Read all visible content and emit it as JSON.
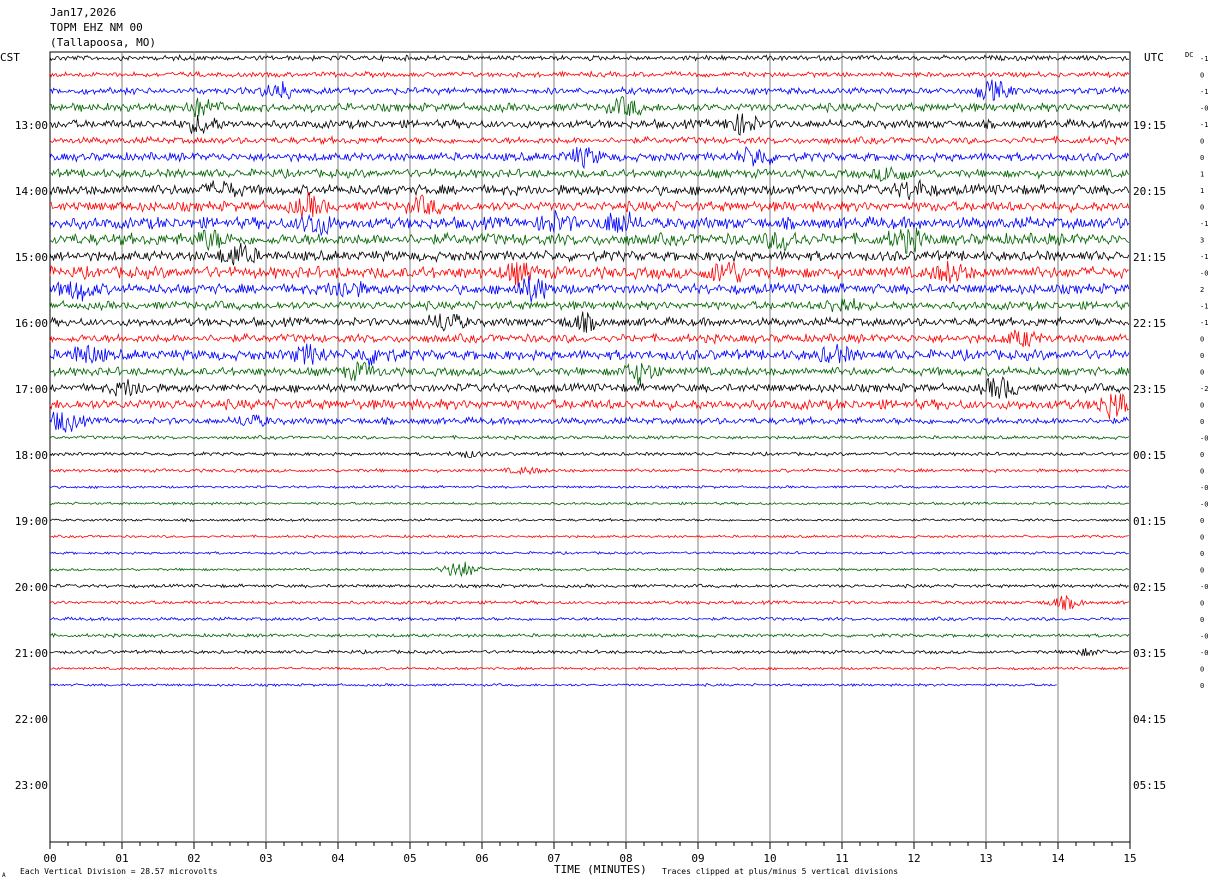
{
  "header": {
    "date": "Jan17,2026",
    "station": "TOPM EHZ NM 00",
    "location": "(Tallapoosa, MO)"
  },
  "left_tz": "CST",
  "right_tz": "UTC",
  "dc_label": "DC",
  "footer": {
    "vertical_division": "Each Vertical Division =   28.57 microvolts",
    "clip_note": "Traces clipped at plus/minus 5 vertical divisions",
    "corner_mark": "A"
  },
  "chart_data": {
    "type": "line",
    "title": "TOPM EHZ NM 00",
    "xlabel": "TIME (MINUTES)",
    "ylabel": "",
    "xlim": [
      0,
      15
    ],
    "x_ticks": [
      "00",
      "01",
      "02",
      "03",
      "04",
      "05",
      "06",
      "07",
      "08",
      "09",
      "10",
      "11",
      "12",
      "13",
      "14",
      "15"
    ],
    "left_hour_labels": [
      "13:00",
      "14:00",
      "15:00",
      "16:00",
      "17:00",
      "18:00",
      "19:00",
      "20:00",
      "21:00",
      "22:00",
      "23:00"
    ],
    "right_hour_labels": [
      "19:15",
      "20:15",
      "21:15",
      "22:15",
      "23:15",
      "00:15",
      "01:15",
      "02:15",
      "03:15",
      "04:15",
      "05:15"
    ],
    "trace_colors": [
      "#000000",
      "#ff0000",
      "#0000ff",
      "#006400"
    ],
    "traces_per_hour": 4,
    "trace_count": 39,
    "last_trace_end_minute": 14,
    "dc_offsets": [
      "-1",
      "0",
      "-1",
      "-0",
      "-1",
      "0",
      "0",
      "1",
      "1",
      "0",
      "-1",
      "3",
      "-1",
      "-0",
      "2",
      "-1",
      "-1",
      "0",
      "0",
      "0",
      "-2",
      "0",
      "0",
      "-0",
      "0",
      "0",
      "-0",
      "-0",
      "0",
      "0",
      "0",
      "0",
      "-0",
      "0",
      "0",
      "-0",
      "-0",
      "0",
      "0"
    ],
    "trace_amplitude": [
      3,
      3,
      4,
      5,
      5,
      4,
      5,
      5,
      6,
      6,
      7,
      7,
      6,
      7,
      6,
      5,
      5,
      5,
      6,
      5,
      5,
      6,
      4,
      2,
      2,
      2,
      1.5,
      1.5,
      1.5,
      1.5,
      1.5,
      1.5,
      2,
      2,
      2,
      2,
      2,
      1.5,
      1.5
    ],
    "events": [
      {
        "trace": 2,
        "minute": 3.2,
        "amp": 8
      },
      {
        "trace": 2,
        "minute": 13.1,
        "amp": 9
      },
      {
        "trace": 3,
        "minute": 2.1,
        "amp": 8
      },
      {
        "trace": 3,
        "minute": 8.0,
        "amp": 8
      },
      {
        "trace": 4,
        "minute": 2.1,
        "amp": 8
      },
      {
        "trace": 4,
        "minute": 9.6,
        "amp": 9
      },
      {
        "trace": 6,
        "minute": 7.4,
        "amp": 8
      },
      {
        "trace": 6,
        "minute": 9.8,
        "amp": 9
      },
      {
        "trace": 7,
        "minute": 11.7,
        "amp": 7
      },
      {
        "trace": 8,
        "minute": 2.4,
        "amp": 7
      },
      {
        "trace": 8,
        "minute": 12.0,
        "amp": 8
      },
      {
        "trace": 9,
        "minute": 3.6,
        "amp": 9
      },
      {
        "trace": 9,
        "minute": 5.2,
        "amp": 7
      },
      {
        "trace": 10,
        "minute": 3.7,
        "amp": 10
      },
      {
        "trace": 10,
        "minute": 7.0,
        "amp": 8
      },
      {
        "trace": 10,
        "minute": 7.9,
        "amp": 10
      },
      {
        "trace": 11,
        "minute": 2.2,
        "amp": 8
      },
      {
        "trace": 11,
        "minute": 10.2,
        "amp": 9
      },
      {
        "trace": 11,
        "minute": 11.9,
        "amp": 9
      },
      {
        "trace": 12,
        "minute": 2.6,
        "amp": 10
      },
      {
        "trace": 13,
        "minute": 9.4,
        "amp": 11
      },
      {
        "trace": 13,
        "minute": 6.5,
        "amp": 8
      },
      {
        "trace": 13,
        "minute": 12.5,
        "amp": 8
      },
      {
        "trace": 14,
        "minute": 0.4,
        "amp": 9
      },
      {
        "trace": 14,
        "minute": 6.7,
        "amp": 11
      },
      {
        "trace": 14,
        "minute": 4.1,
        "amp": 8
      },
      {
        "trace": 15,
        "minute": 11.0,
        "amp": 7
      },
      {
        "trace": 16,
        "minute": 5.5,
        "amp": 9
      },
      {
        "trace": 16,
        "minute": 7.4,
        "amp": 7
      },
      {
        "trace": 17,
        "minute": 13.5,
        "amp": 7
      },
      {
        "trace": 18,
        "minute": 0.5,
        "amp": 8
      },
      {
        "trace": 18,
        "minute": 3.6,
        "amp": 8
      },
      {
        "trace": 18,
        "minute": 4.5,
        "amp": 8
      },
      {
        "trace": 18,
        "minute": 10.9,
        "amp": 7
      },
      {
        "trace": 19,
        "minute": 8.2,
        "amp": 10
      },
      {
        "trace": 19,
        "minute": 4.3,
        "amp": 7
      },
      {
        "trace": 20,
        "minute": 13.2,
        "amp": 10
      },
      {
        "trace": 20,
        "minute": 1.1,
        "amp": 7
      },
      {
        "trace": 21,
        "minute": 14.8,
        "amp": 13
      },
      {
        "trace": 22,
        "minute": 0.2,
        "amp": 10
      },
      {
        "trace": 22,
        "minute": 2.8,
        "amp": 5
      },
      {
        "trace": 24,
        "minute": 5.8,
        "amp": 3
      },
      {
        "trace": 25,
        "minute": 6.6,
        "amp": 3
      },
      {
        "trace": 31,
        "minute": 5.7,
        "amp": 9
      },
      {
        "trace": 33,
        "minute": 14.1,
        "amp": 6
      },
      {
        "trace": 36,
        "minute": 14.4,
        "amp": 3
      }
    ]
  }
}
